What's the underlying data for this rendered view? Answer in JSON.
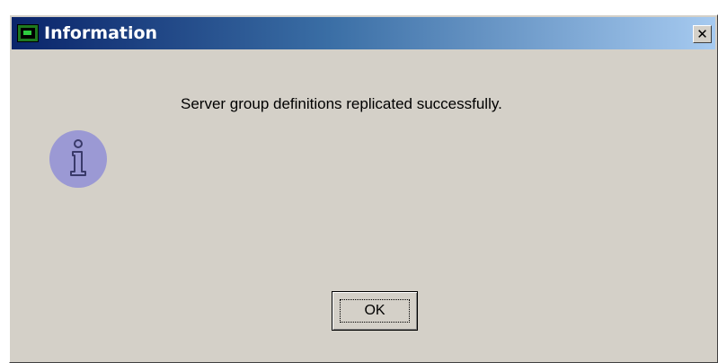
{
  "window": {
    "title": "Information",
    "close_glyph": "✕",
    "app_icon": "java-console-icon"
  },
  "content": {
    "message": "Server group definitions replicated successfully.",
    "icon": "information-icon",
    "ok_label": "OK"
  },
  "colors": {
    "dialog_bg": "#d4d0c8",
    "titlebar_start": "#0a246a",
    "titlebar_end": "#a6caf0",
    "info_icon_bg": "#9b99d4"
  }
}
